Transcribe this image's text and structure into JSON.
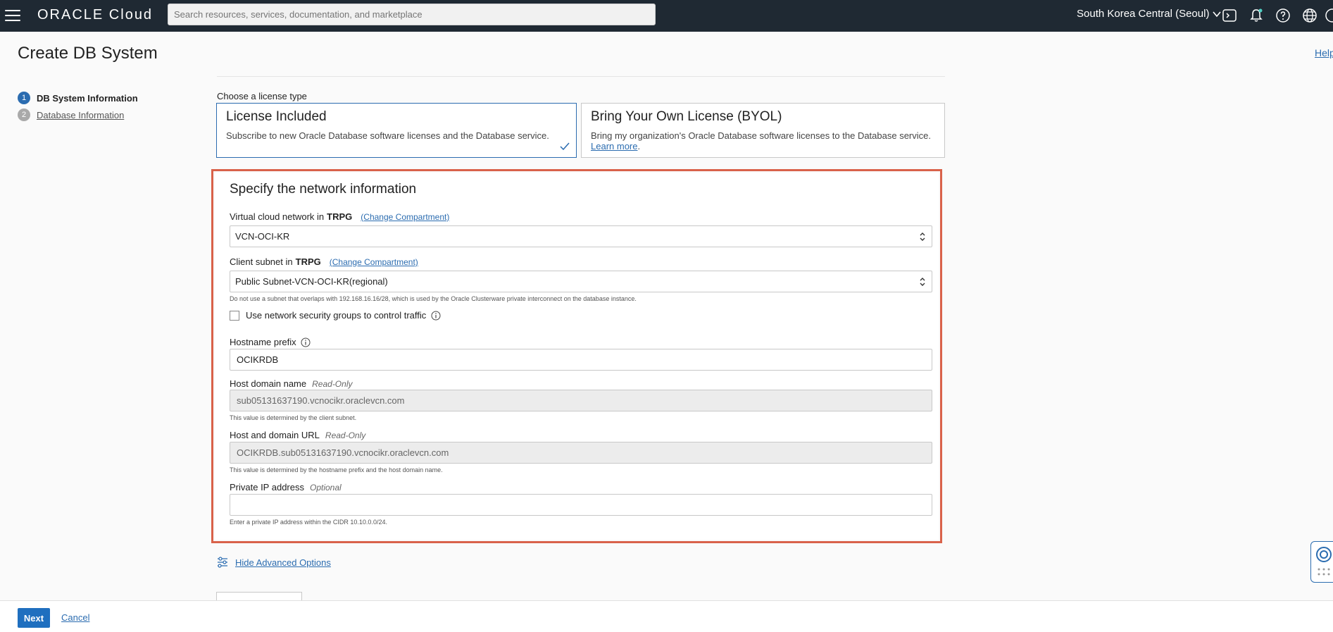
{
  "header": {
    "logo_text": "ORACLE Cloud",
    "search_placeholder": "Search resources, services, documentation, and marketplace",
    "region": "South Korea Central (Seoul)",
    "icons": [
      "menu-icon",
      "cloud-shell-icon",
      "bell-icon",
      "help-icon",
      "globe-icon",
      "profile-icon"
    ]
  },
  "page": {
    "title": "Create DB System",
    "help_label": "Help"
  },
  "steps": [
    {
      "number": "1",
      "label": "DB System Information"
    },
    {
      "number": "2",
      "label": "Database Information"
    }
  ],
  "license": {
    "prompt": "Choose a license type",
    "options": [
      {
        "title": "License Included",
        "description": "Subscribe to new Oracle Database software licenses and the Database service.",
        "selected": true
      },
      {
        "title": "Bring Your Own License (BYOL)",
        "description": "Bring my organization's Oracle Database software licenses to the Database service.",
        "link": "Learn more",
        "selected": false
      }
    ]
  },
  "network": {
    "title": "Specify the network information",
    "vcn": {
      "label": "Virtual cloud network in",
      "compartment": "TRPG",
      "change_link": "(Change Compartment)",
      "value": "VCN-OCI-KR"
    },
    "subnet": {
      "label": "Client subnet in",
      "compartment": "TRPG",
      "change_link": "(Change Compartment)",
      "value": "Public Subnet-VCN-OCI-KR(regional)",
      "hint": "Do not use a subnet that overlaps with 192.168.16.16/28, which is used by the Oracle Clusterware private interconnect on the database instance."
    },
    "nsg_checkbox": {
      "label": "Use network security groups to control traffic",
      "checked": false
    },
    "hostname_prefix": {
      "label": "Hostname prefix",
      "value": "OCIKRDB"
    },
    "host_domain": {
      "label": "Host domain name",
      "tag": "Read-Only",
      "value": "sub05131637190.vcnocikr.oraclevcn.com",
      "hint": "This value is determined by the client subnet."
    },
    "host_domain_url": {
      "label": "Host and domain URL",
      "tag": "Read-Only",
      "value": "OCIKRDB.sub05131637190.vcnocikr.oraclevcn.com",
      "hint": "This value is determined by the hostname prefix and the host domain name."
    },
    "private_ip": {
      "label": "Private IP address",
      "tag": "Optional",
      "value": "",
      "hint": "Enter a private IP address within the CIDR 10.10.0.0/24."
    }
  },
  "advanced_link": "Hide Advanced Options",
  "footer": {
    "next_label": "Next",
    "cancel_label": "Cancel"
  },
  "colors": {
    "topbar": "#1f2933",
    "accent": "#2b6cb0",
    "highlight": "#d9624a"
  }
}
